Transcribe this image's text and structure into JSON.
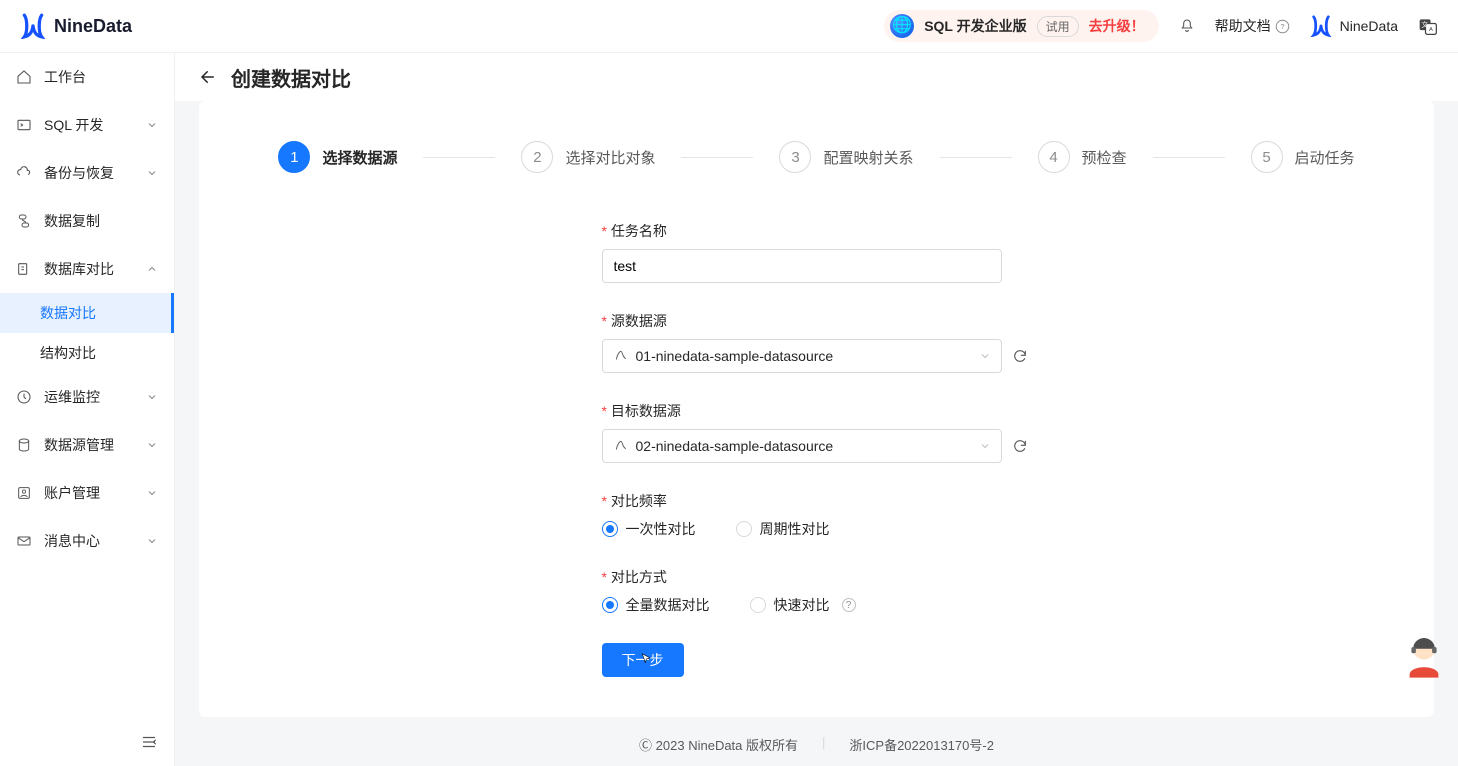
{
  "brand": {
    "name": "NineData"
  },
  "header": {
    "plan_name": "SQL 开发企业版",
    "trial_tag": "试用",
    "upgrade_text": "去升级！",
    "help_text": "帮助文档",
    "account_name": "NineData"
  },
  "sidebar": {
    "items": [
      {
        "label": "工作台"
      },
      {
        "label": "SQL 开发"
      },
      {
        "label": "备份与恢复"
      },
      {
        "label": "数据复制"
      },
      {
        "label": "数据库对比"
      },
      {
        "label": "运维监控"
      },
      {
        "label": "数据源管理"
      },
      {
        "label": "账户管理"
      },
      {
        "label": "消息中心"
      }
    ],
    "sub_items": [
      {
        "label": "数据对比"
      },
      {
        "label": "结构对比"
      }
    ]
  },
  "page": {
    "title": "创建数据对比"
  },
  "steps": [
    {
      "n": "1",
      "label": "选择数据源"
    },
    {
      "n": "2",
      "label": "选择对比对象"
    },
    {
      "n": "3",
      "label": "配置映射关系"
    },
    {
      "n": "4",
      "label": "预检查"
    },
    {
      "n": "5",
      "label": "启动任务"
    }
  ],
  "form": {
    "task_name_label": "任务名称",
    "task_name_value": "test",
    "source_label": "源数据源",
    "source_value": "01-ninedata-sample-datasource",
    "target_label": "目标数据源",
    "target_value": "02-ninedata-sample-datasource",
    "freq_label": "对比频率",
    "freq_opts": [
      "一次性对比",
      "周期性对比"
    ],
    "mode_label": "对比方式",
    "mode_opts": [
      "全量数据对比",
      "快速对比"
    ],
    "submit_label": "下一步"
  },
  "footer": {
    "copyright": "2023 NineData 版权所有",
    "icp": "浙ICP备2022013170号-2"
  }
}
